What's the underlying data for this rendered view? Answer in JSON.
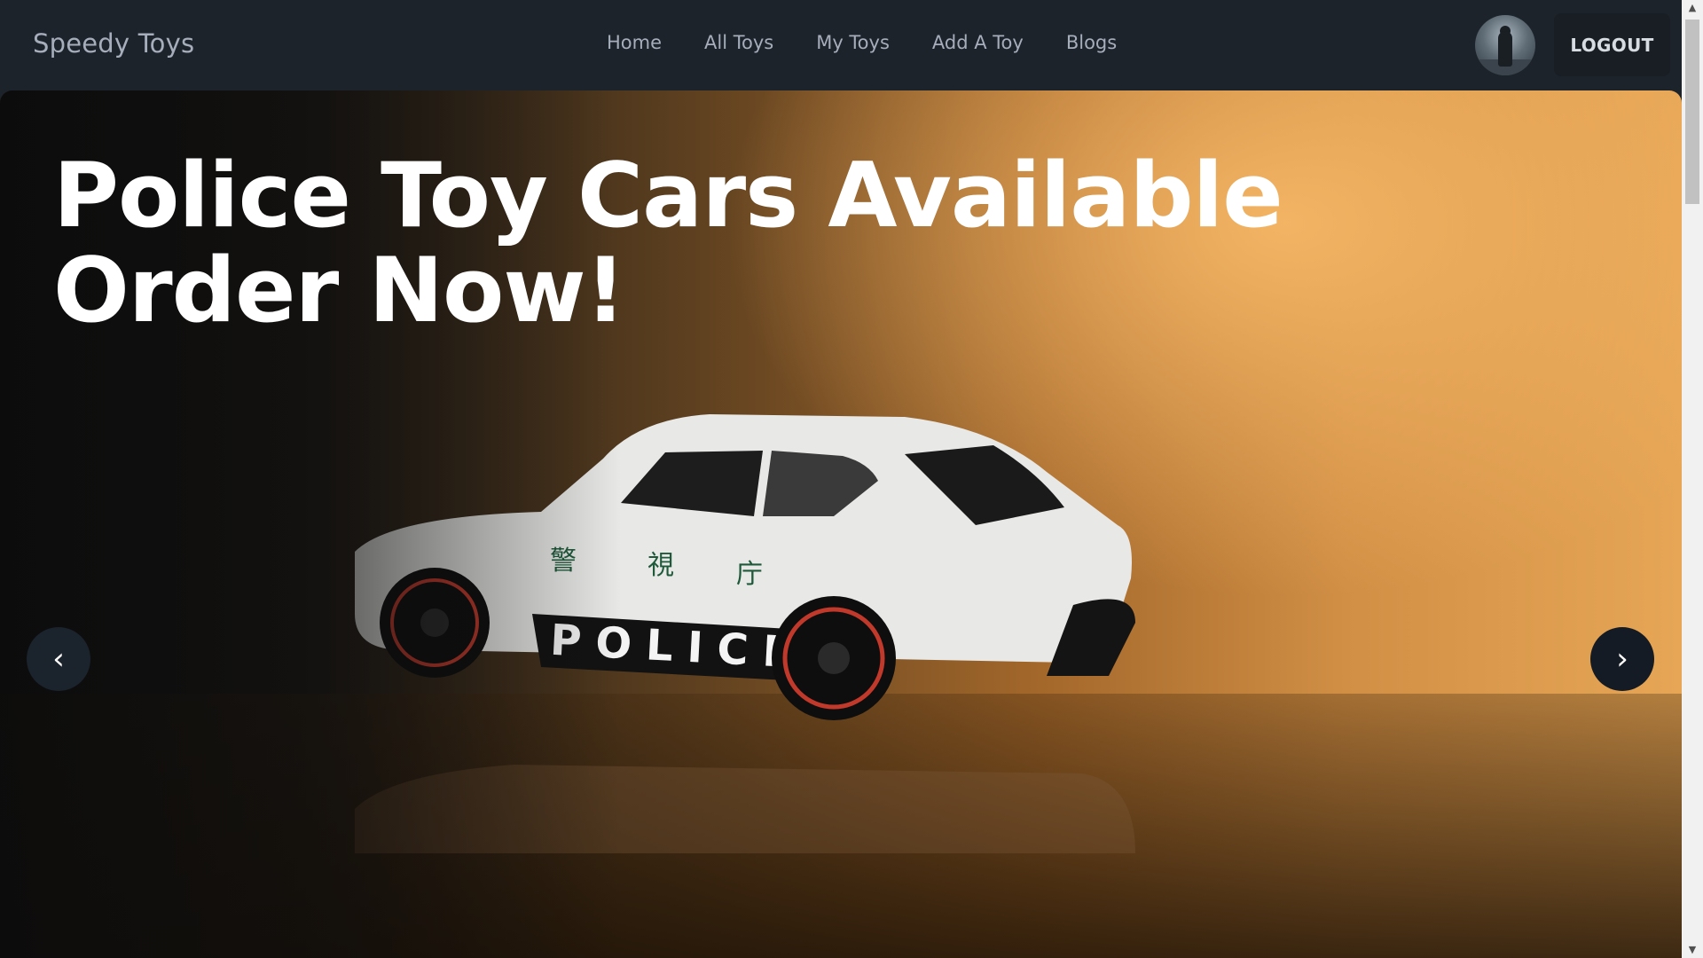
{
  "brand": "Speedy Toys",
  "nav": {
    "links": [
      "Home",
      "All Toys",
      "My Toys",
      "Add A Toy",
      "Blogs"
    ]
  },
  "user": {
    "avatar_icon": "user-avatar-photo",
    "logout_label": "LOGOUT"
  },
  "hero": {
    "headline_line1": "Police Toy Cars Available",
    "headline_line2": "Order Now!",
    "image_subject": "white police toy car",
    "car_lettering": "POLICE",
    "car_kanji": [
      "警",
      "視",
      "庁"
    ],
    "prev_label": "‹",
    "next_label": "›"
  },
  "colors": {
    "navbar_bg": "#1d232a",
    "nav_text": "#a6adbb",
    "logout_bg": "#191e24",
    "arrow_bg": "#1b232c",
    "headline": "#ffffff"
  }
}
